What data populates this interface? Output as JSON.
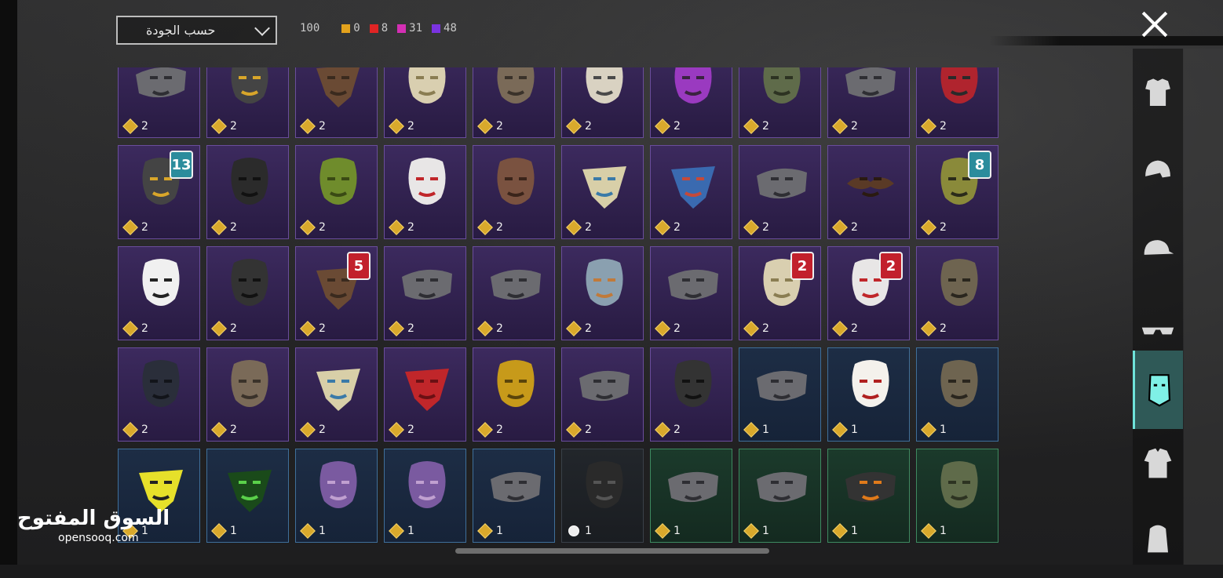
{
  "filter": {
    "label": "حسب الجودة"
  },
  "counts": {
    "total": "100",
    "tiers": [
      {
        "color": "#e3a21c",
        "value": "0"
      },
      {
        "color": "#e02424",
        "value": "8"
      },
      {
        "color": "#d42fb4",
        "value": "31"
      },
      {
        "color": "#7a33e0",
        "value": "48"
      }
    ]
  },
  "sidebar": [
    {
      "icon": "outfit-icon",
      "active": false
    },
    {
      "icon": "helmet-icon",
      "active": false
    },
    {
      "icon": "cap-icon",
      "active": false
    },
    {
      "icon": "glasses-icon",
      "active": false
    },
    {
      "icon": "mask-icon",
      "active": true
    },
    {
      "icon": "jacket-icon",
      "active": false
    },
    {
      "icon": "backpack-icon",
      "active": false
    }
  ],
  "grid": {
    "rows": [
      [
        {
          "icon": "face-mask-icon",
          "q": "purple",
          "count": "2"
        },
        {
          "icon": "goggle-mask-icon",
          "q": "purple",
          "count": "2"
        },
        {
          "icon": "scarf-icon",
          "q": "purple",
          "count": "2"
        },
        {
          "icon": "skull-mask-icon",
          "q": "purple",
          "count": "2"
        },
        {
          "icon": "half-mask-icon",
          "q": "purple",
          "count": "2"
        },
        {
          "icon": "eye-mask-icon",
          "q": "purple",
          "count": "2"
        },
        {
          "icon": "visor-mask-icon",
          "q": "purple",
          "count": "2"
        },
        {
          "icon": "gas-mask-icon",
          "q": "purple",
          "count": "2"
        },
        {
          "icon": "face-mask-icon",
          "q": "purple",
          "count": "2"
        },
        {
          "icon": "red-mask-icon",
          "q": "purple",
          "count": "2"
        }
      ],
      [
        {
          "icon": "goggle-mask-icon",
          "q": "purple",
          "count": "2",
          "level": "13",
          "levelColor": "teal"
        },
        {
          "icon": "balaclava-icon",
          "q": "purple",
          "count": "2"
        },
        {
          "icon": "shemagh-icon",
          "q": "purple",
          "count": "2"
        },
        {
          "icon": "clown-mask-icon",
          "q": "purple",
          "count": "2"
        },
        {
          "icon": "teeth-mask-icon",
          "q": "purple",
          "count": "2"
        },
        {
          "icon": "bandana-icon",
          "q": "purple",
          "count": "2"
        },
        {
          "icon": "bandana-blue-icon",
          "q": "purple",
          "count": "2"
        },
        {
          "icon": "face-mask-icon",
          "q": "purple",
          "count": "2"
        },
        {
          "icon": "mustache-icon",
          "q": "purple",
          "count": "2"
        },
        {
          "icon": "camo-mask-icon",
          "q": "purple",
          "count": "2",
          "level": "8",
          "levelColor": "teal"
        }
      ],
      [
        {
          "icon": "painted-mask-icon",
          "q": "purple",
          "count": "2"
        },
        {
          "icon": "black-mask-icon",
          "q": "purple",
          "count": "2"
        },
        {
          "icon": "scarf-icon",
          "q": "purple",
          "count": "2",
          "level": "5",
          "levelColor": "red"
        },
        {
          "icon": "face-mask-icon",
          "q": "purple",
          "count": "2"
        },
        {
          "icon": "face-mask-icon",
          "q": "purple",
          "count": "2"
        },
        {
          "icon": "hockey-mask-icon",
          "q": "purple",
          "count": "2"
        },
        {
          "icon": "face-mask-icon",
          "q": "purple",
          "count": "2"
        },
        {
          "icon": "skull-mask-icon",
          "q": "purple",
          "count": "2",
          "level": "2",
          "levelColor": "red"
        },
        {
          "icon": "clown-mask-icon",
          "q": "purple",
          "count": "2",
          "level": "2",
          "levelColor": "red"
        },
        {
          "icon": "scary-mask-icon",
          "q": "purple",
          "count": "2"
        }
      ],
      [
        {
          "icon": "demon-mask-icon",
          "q": "purple",
          "count": "2"
        },
        {
          "icon": "half-mask-icon",
          "q": "purple",
          "count": "2"
        },
        {
          "icon": "bandana-icon",
          "q": "purple",
          "count": "2"
        },
        {
          "icon": "red-scarf-icon",
          "q": "purple",
          "count": "2"
        },
        {
          "icon": "gold-mask-icon",
          "q": "purple",
          "count": "2"
        },
        {
          "icon": "face-mask-icon",
          "q": "purple",
          "count": "2"
        },
        {
          "icon": "black-mask-icon",
          "q": "purple",
          "count": "2"
        },
        {
          "icon": "face-mask-icon",
          "q": "blue",
          "count": "1"
        },
        {
          "icon": "noh-mask-icon",
          "q": "blue",
          "count": "1"
        },
        {
          "icon": "scary-mask-icon",
          "q": "blue",
          "count": "1"
        }
      ],
      [
        {
          "icon": "bandana-yellow-icon",
          "q": "blue",
          "count": "1"
        },
        {
          "icon": "bandana-web-icon",
          "q": "blue",
          "count": "1"
        },
        {
          "icon": "drama-mask-icon",
          "q": "blue",
          "count": "1"
        },
        {
          "icon": "drama-mask-icon",
          "q": "blue",
          "count": "1"
        },
        {
          "icon": "face-mask-icon",
          "q": "blue",
          "count": "1"
        },
        {
          "icon": "respirator-icon",
          "q": "gray",
          "count": "1",
          "cloud": true
        },
        {
          "icon": "face-mask-icon",
          "q": "green",
          "count": "1"
        },
        {
          "icon": "face-mask-icon",
          "q": "green",
          "count": "1"
        },
        {
          "icon": "flame-mask-icon",
          "q": "green",
          "count": "1"
        },
        {
          "icon": "gas-mask-icon",
          "q": "green",
          "count": "1"
        }
      ]
    ]
  },
  "watermark": {
    "arabic": "السوق المفتوح",
    "latin": "opensooq.com"
  }
}
